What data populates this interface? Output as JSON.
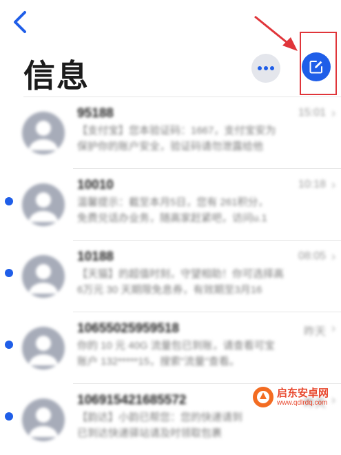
{
  "header": {
    "title": "信息",
    "back_icon": "chevron-left-icon",
    "more_icon": "ellipsis-icon",
    "compose_icon": "compose-icon"
  },
  "colors": {
    "accent": "#1f5ee8",
    "highlight": "#e0353a",
    "avatar": "#a7acb9",
    "unread": "#1f5ee8"
  },
  "messages": [
    {
      "sender": "95188",
      "time": "15:01",
      "preview": [
        "【支付宝】您本验证码：1667，支付宝安为",
        "保护你的账户安全，验证码请勿泄露给他"
      ],
      "unread": false
    },
    {
      "sender": "10010",
      "time": "10:18",
      "preview": [
        "温馨提示：截至本月5日，您有 261积分，",
        "免费兑话办业务，随高家赶紧吧，访问u.1"
      ],
      "unread": true
    },
    {
      "sender": "10188",
      "time": "08:05",
      "preview": [
        "【天猫】的超值时刻，守望相助！你可选择高",
        "6万元 30 天期限免息券，有效期至3月16"
      ],
      "unread": true
    },
    {
      "sender": "10655025959518",
      "time": "昨天",
      "preview": [
        "你的 10 元 40G 流量包已到账，请查看可宝",
        "账户 132*****15，搜索\"流量\"查看。"
      ],
      "unread": true
    },
    {
      "sender": "106915421685572",
      "time": "昨天",
      "preview": [
        "【韵达】小韵已帮您：您的快递请到",
        "已到达快递驿站请及时领取包裹"
      ],
      "unread": true
    }
  ],
  "watermark": {
    "name": "启东安卓网",
    "url": "www.qdlrdq.com"
  }
}
